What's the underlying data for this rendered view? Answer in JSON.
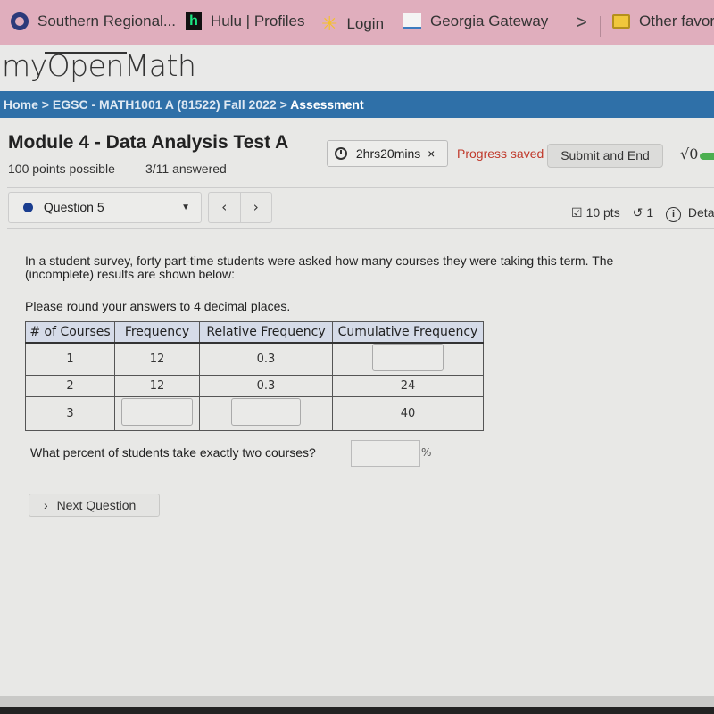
{
  "browser": {
    "bookmarks": [
      {
        "label": "Southern Regional...",
        "icon": "ring-logo-icon"
      },
      {
        "label": "Hulu | Profiles",
        "icon": "hulu-icon"
      },
      {
        "label": "Login",
        "icon": "walmart-spark-icon"
      },
      {
        "label": "Georgia Gateway",
        "icon": "georgia-gateway-icon"
      }
    ],
    "overflow_chevron": ">",
    "other_favorites": "Other favori"
  },
  "site": {
    "logo": "myOpenMath"
  },
  "breadcrumb": {
    "home": "Home",
    "sep": ">",
    "course": "EGSC - MATH1001 A (81522) Fall 2022",
    "current": "Assessment"
  },
  "assessment": {
    "title": "Module 4 - Data Analysis Test A",
    "points_possible": "100 points possible",
    "answered": "3/11 answered",
    "timer": "2hrs20mins",
    "timer_close": "×",
    "progress_status": "Progress saved",
    "submit_label": "Submit and End",
    "math_toggle": "√0"
  },
  "question_nav": {
    "selected_question": "Question 5",
    "prev": "‹",
    "next": "›",
    "points": "10 pts",
    "retries": "1",
    "details": "Deta"
  },
  "question": {
    "text": "In a student survey, forty part-time students were asked how many courses they were taking this term. The (incomplete) results are shown below:",
    "instruction": "Please round your answers to 4 decimal places.",
    "table": {
      "headers": [
        "# of Courses",
        "Frequency",
        "Relative Frequency",
        "Cumulative Frequency"
      ],
      "rows": [
        {
          "courses": "1",
          "frequency": "12",
          "relative": "0.3",
          "cumulative": ""
        },
        {
          "courses": "2",
          "frequency": "12",
          "relative": "0.3",
          "cumulative": "24"
        },
        {
          "courses": "3",
          "frequency": "",
          "relative": "",
          "cumulative": "40"
        }
      ]
    },
    "percent_prompt": "What percent of students take exactly two courses?",
    "percent_value": "",
    "percent_sign": "%",
    "next_button": "Next Question"
  }
}
